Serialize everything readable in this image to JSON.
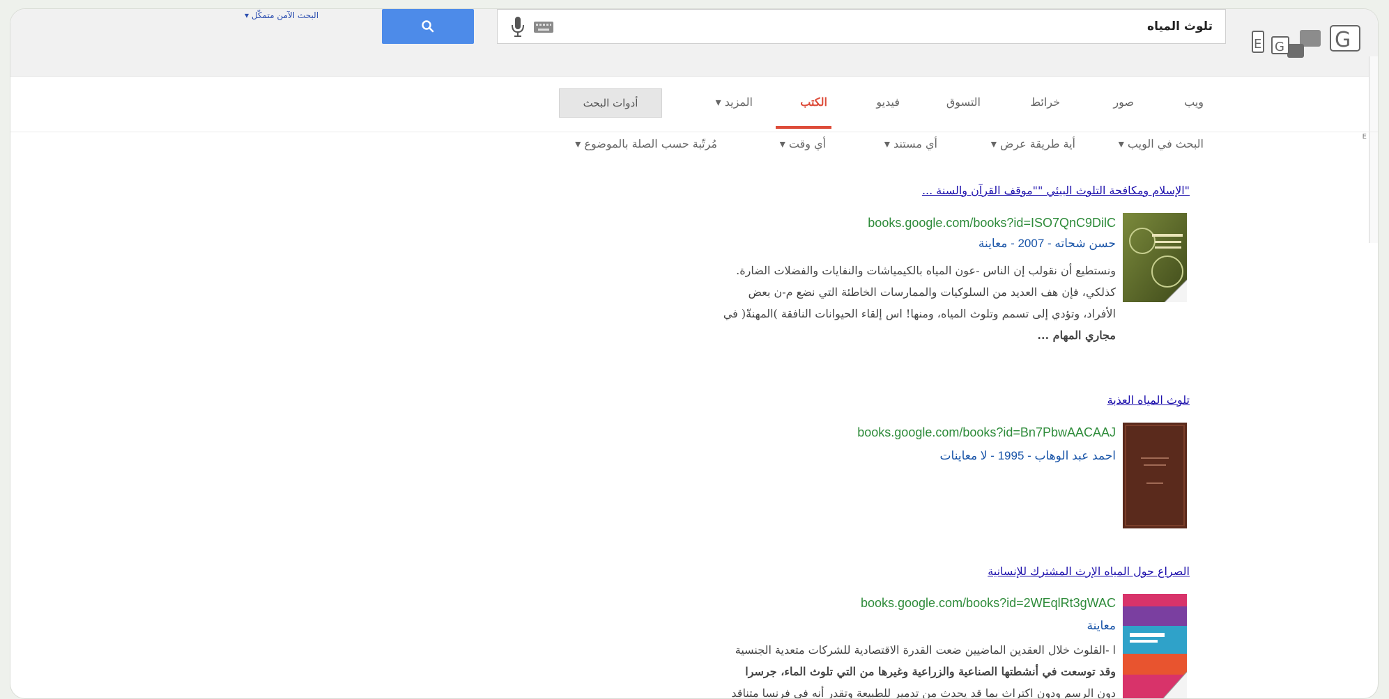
{
  "search": {
    "query": "تلوث المياه",
    "button_icon": "search-icon",
    "safe_search_label": "البحث الآمن متمكّل ▾"
  },
  "logo": {
    "icon": "google-logo-icon"
  },
  "tabs": [
    {
      "label": "ويب",
      "active": false
    },
    {
      "label": "صور",
      "active": false
    },
    {
      "label": "خرائط",
      "active": false
    },
    {
      "label": "التسوق",
      "active": false
    },
    {
      "label": "فيديو",
      "active": false
    },
    {
      "label": "الكتب",
      "active": true
    },
    {
      "label": "المزيد ▾",
      "active": false
    }
  ],
  "tools_button": "أدوات البحث",
  "filters": [
    {
      "label": "البحث في الويب ▾"
    },
    {
      "label": "أية طريقة عرض ▾"
    },
    {
      "label": "أي مستند ▾"
    },
    {
      "label": "أي وقت ▾"
    },
    {
      "label": "مُرتّبة حسب الصلة بالموضوع ▾"
    }
  ],
  "results": [
    {
      "title": "\"الإسلام ومكافحة التلوث البيئي \"\"موقف القرآن والسنة ...",
      "url": "books.google.com/books?id=ISO7QnC9DilC",
      "meta": "حسن شحاته - 2007 - معاينة",
      "snippet_lines": [
        "ونستطيع أن نقولب إن الناس -عون المياه بالكيمياشات والنفايات والفضلات الضارة.",
        "كذلكي، فإن هف العديد من السلوكيات والممارسات الخاطئة التي نضع م-ن بعض",
        "الأفراد، وتؤدي إلى تسمم وتلوث المياه، ومنها! اس إلقاء الحيوانات النافقة )المهنةّ( في",
        "مجاري المهام ..."
      ],
      "snippet_bold": [
        "وتلوث المياه",
        "في",
        "..."
      ]
    },
    {
      "title": "تلوث المياه العذبة",
      "url": "books.google.com/books?id=Bn7PbwAACAAJ",
      "meta": "احمد عبد الوهاب - 1995 - لا معاينات",
      "snippet_lines": []
    },
    {
      "title": "الصراع حول المياه الإرث المشترك للإنسانية",
      "url": "books.google.com/books?id=2WEqlRt3gWAC",
      "meta": "معاينة",
      "snippet_lines": [
        "ا -القلوث خلال العقدين الماضيين ضعت القدرة الاقتصادية للشركات متعدية الجنسية",
        "وقد توسعت في أنشطتها الصناعية والزراعية وغيرها من التي تلوث الماء، جرسرا",
        "دون الرسم ودون اكتراث بما قد يحدث من تدمير للطبيعة وتقدر أنه في فرنسا متناقد"
      ]
    }
  ],
  "colors": {
    "accent": "#dd4b39",
    "link": "#1a0dab",
    "url": "#2e8b3a",
    "search_button": "#4d8be9"
  }
}
